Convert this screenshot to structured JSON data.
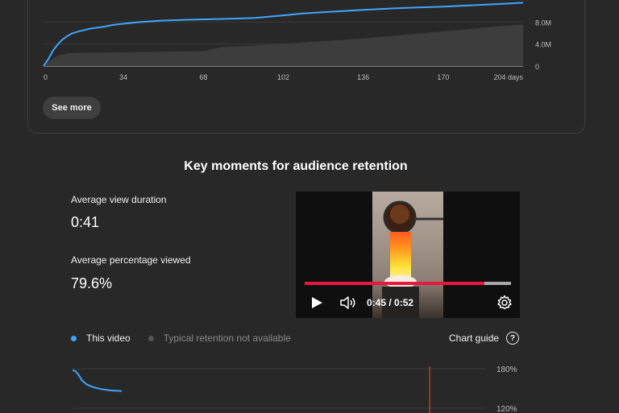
{
  "top_card": {
    "see_more_label": "See more",
    "chart_data": {
      "type": "line",
      "x_ticks": [
        "0",
        "34",
        "68",
        "102",
        "136",
        "170",
        "204 days"
      ],
      "y_ticks": [
        "0",
        "4.0M",
        "8.0M"
      ],
      "x_range": [
        0,
        204
      ],
      "ylim": [
        0,
        12000000
      ],
      "series": [
        {
          "color": "#3ea6ff",
          "x": [
            0,
            2,
            4,
            6,
            8,
            10,
            12,
            15,
            20,
            25,
            30,
            40,
            50,
            60,
            80,
            90,
            102,
            110,
            120,
            136,
            150,
            170,
            190,
            204
          ],
          "values": [
            0,
            1200000,
            2800000,
            3900000,
            4800000,
            5400000,
            5900000,
            6300000,
            6800000,
            7100000,
            7500000,
            7950000,
            8250000,
            8400000,
            8600000,
            8750000,
            9200000,
            9550000,
            9800000,
            10200000,
            10500000,
            10800000,
            11200000,
            11500000
          ]
        },
        {
          "color": "#3d3d3d",
          "x": [
            0,
            3,
            6,
            10,
            15,
            25,
            34,
            50,
            68,
            75,
            100,
            136,
            170,
            204
          ],
          "values": [
            0,
            1000000,
            1900000,
            2300000,
            2400000,
            2450000,
            2500000,
            2600000,
            2700000,
            3400000,
            4000000,
            5000000,
            6300000,
            7600000
          ]
        }
      ]
    }
  },
  "key_moments": {
    "title": "Key moments for audience retention",
    "avg_view_duration_label": "Average view duration",
    "avg_view_duration_value": "0:41",
    "avg_pct_viewed_label": "Average percentage viewed",
    "avg_pct_viewed_value": "79.6%"
  },
  "player": {
    "time": "0:45 / 0:52",
    "progress_fraction": 0.87,
    "play_icon": "play-icon",
    "volume_icon": "volume-icon",
    "settings_icon": "gear-icon"
  },
  "legend": {
    "this_video": "This video",
    "this_video_color": "#3ea6ff",
    "typical": "Typical retention not available",
    "typical_color": "#555555",
    "chart_guide": "Chart guide"
  },
  "retention_chart": {
    "chart_data": {
      "type": "line",
      "y_ticks": [
        "180%",
        "120%"
      ],
      "ylim": [
        100,
        180
      ],
      "x_range": [
        0,
        52
      ],
      "playhead": 45,
      "series": [
        {
          "color": "#3ea6ff",
          "x": [
            0,
            0.4,
            0.8,
            1.2,
            1.8,
            2.6,
            3.6,
            4.8,
            6.2
          ],
          "values": [
            178,
            176,
            170,
            162,
            156,
            152,
            149,
            147,
            146
          ]
        }
      ]
    }
  }
}
